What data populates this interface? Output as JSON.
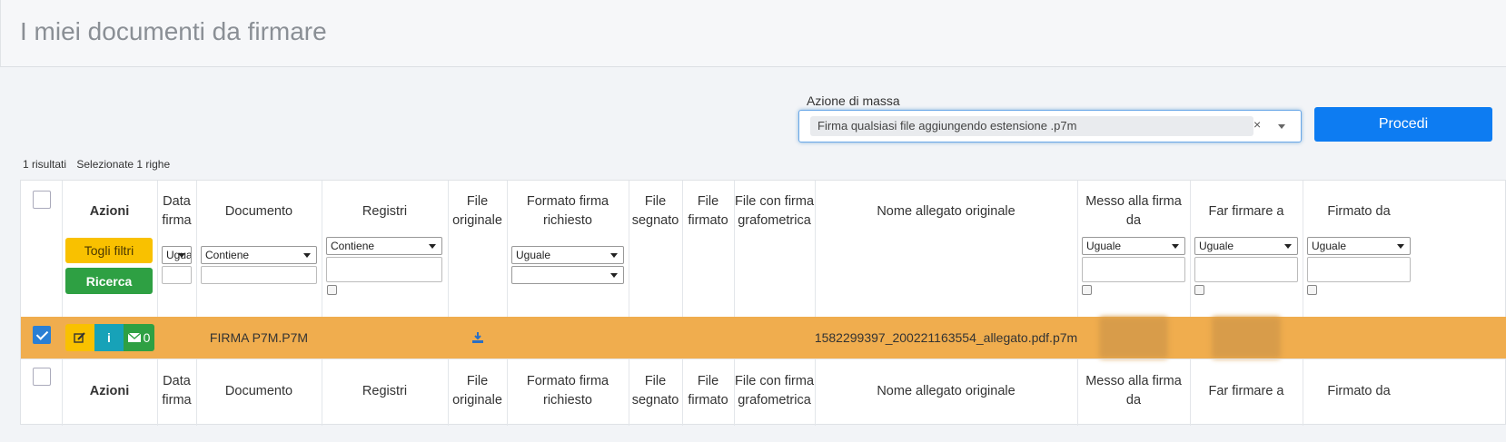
{
  "page": {
    "title": "I miei documenti da firmare"
  },
  "mass_action": {
    "label": "Azione di massa",
    "selected": "Firma qualsiasi file aggiungendo estensione .p7m",
    "clear": "×",
    "submit": "Procedi"
  },
  "counts": {
    "results": "1 risultati",
    "selected": "Selezionate 1 righe"
  },
  "columns": [
    "Azioni",
    "Data firma",
    "Documento",
    "Registri",
    "File originale",
    "Formato firma richiesto",
    "File segnato",
    "File firmato",
    "File con firma grafometrica",
    "Nome allegato originale",
    "Messo alla firma da",
    "Far firmare a",
    "Firmato da"
  ],
  "filters": {
    "togli_filtri": "Togli filtri",
    "ricerca": "Ricerca",
    "data_firma": "Uguale",
    "documento": "Contiene",
    "registri": "Contiene",
    "formato": "Uguale",
    "formato2": "",
    "messo": "Uguale",
    "far_firmare": "Uguale",
    "firmato_da": "Uguale"
  },
  "row": {
    "documento": "FIRMA P7M.P7M",
    "nome_allegato": "1582299397_200221163554_allegato.pdf.p7m",
    "mail_count": "0",
    "selected": true
  },
  "colors": {
    "highlight": "#f0ad4e",
    "primary": "#0d7cf2",
    "yellow": "#f9c100",
    "green": "#2ea043",
    "teal": "#17a2b8"
  }
}
